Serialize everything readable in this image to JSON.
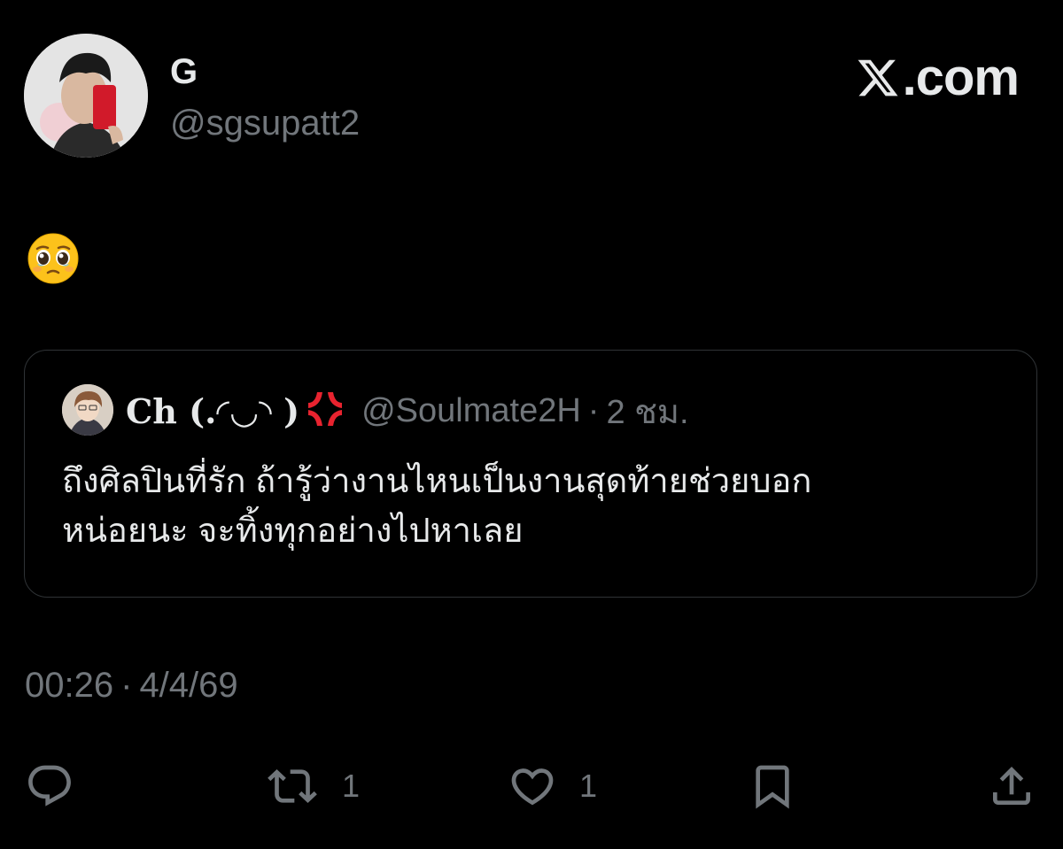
{
  "author": {
    "display_name": "G",
    "handle": "@sgsupatt2"
  },
  "brand": {
    "label": ".com"
  },
  "tweet": {
    "emoji_icon": "pleading-face-emoji",
    "timestamp_time": "00:26",
    "timestamp_sep": "·",
    "timestamp_date": "4/4/69"
  },
  "quote": {
    "name": "Ch (.◜◡◝ )",
    "name_icon": "anger-symbol-emoji",
    "handle": "@Soulmate2H",
    "sep": "·",
    "time": "2 ชม.",
    "text_line1": "ถึงศิลปินที่รัก ถ้ารู้ว่างานไหนเป็นงานสุดท้ายช่วยบอก",
    "text_line2": "หน่อยนะ จะทิ้งทุกอย่างไปหาเลย"
  },
  "actions": {
    "reply_icon": "reply-icon",
    "retweet_icon": "retweet-icon",
    "retweet_count": "1",
    "like_icon": "heart-icon",
    "like_count": "1",
    "bookmark_icon": "bookmark-icon",
    "share_icon": "share-icon"
  },
  "colors": {
    "background": "#000000",
    "primary_text": "#e7e9ea",
    "secondary_text": "#71767b",
    "border": "#2f3336"
  }
}
